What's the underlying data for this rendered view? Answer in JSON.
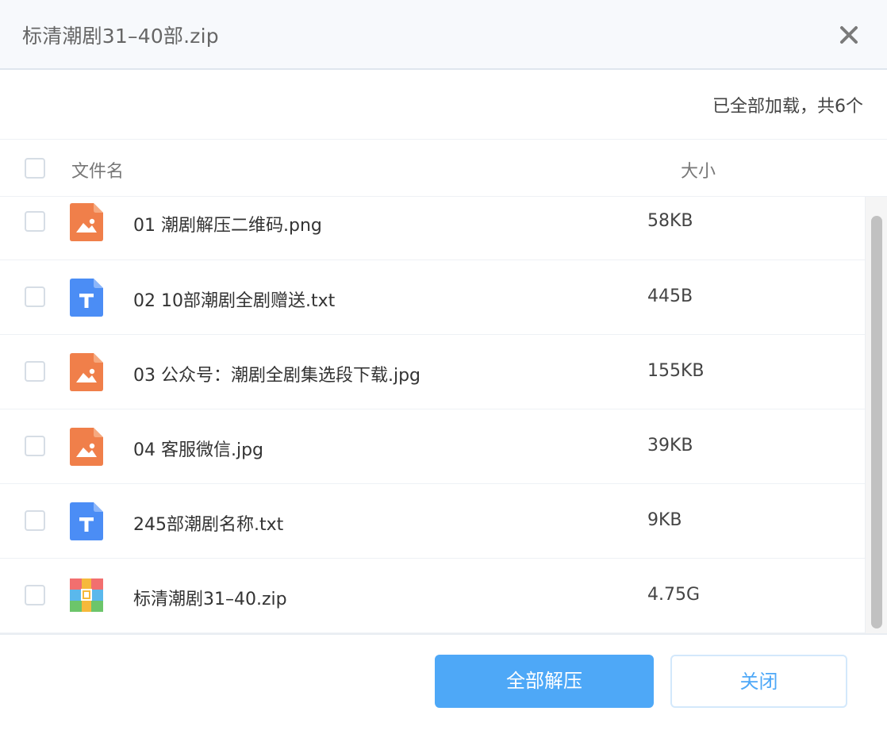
{
  "dialog": {
    "title": "标清潮剧31–40部.zip",
    "close_icon": "close-icon"
  },
  "status": {
    "text": "已全部加载，共6个"
  },
  "columns": {
    "name": "文件名",
    "size": "大小"
  },
  "files": [
    {
      "name": "01 潮剧解压二维码.png",
      "size": "58KB",
      "icon": "image-file-icon"
    },
    {
      "name": "02 10部潮剧全剧赠送.txt",
      "size": "445B",
      "icon": "text-file-icon"
    },
    {
      "name": "03 公众号：潮剧全剧集选段下载.jpg",
      "size": "155KB",
      "icon": "image-file-icon"
    },
    {
      "name": "04 客服微信.jpg",
      "size": "39KB",
      "icon": "image-file-icon"
    },
    {
      "name": "245部潮剧名称.txt",
      "size": "9KB",
      "icon": "text-file-icon"
    },
    {
      "name": "标清潮剧31–40.zip",
      "size": "4.75G",
      "icon": "archive-file-icon"
    }
  ],
  "buttons": {
    "extract_all": "全部解压",
    "close": "关闭"
  },
  "colors": {
    "accent": "#4ea8f7",
    "image_icon": "#f07f4a",
    "text_icon": "#4b8df5",
    "header_bg": "#f7f9fc"
  }
}
